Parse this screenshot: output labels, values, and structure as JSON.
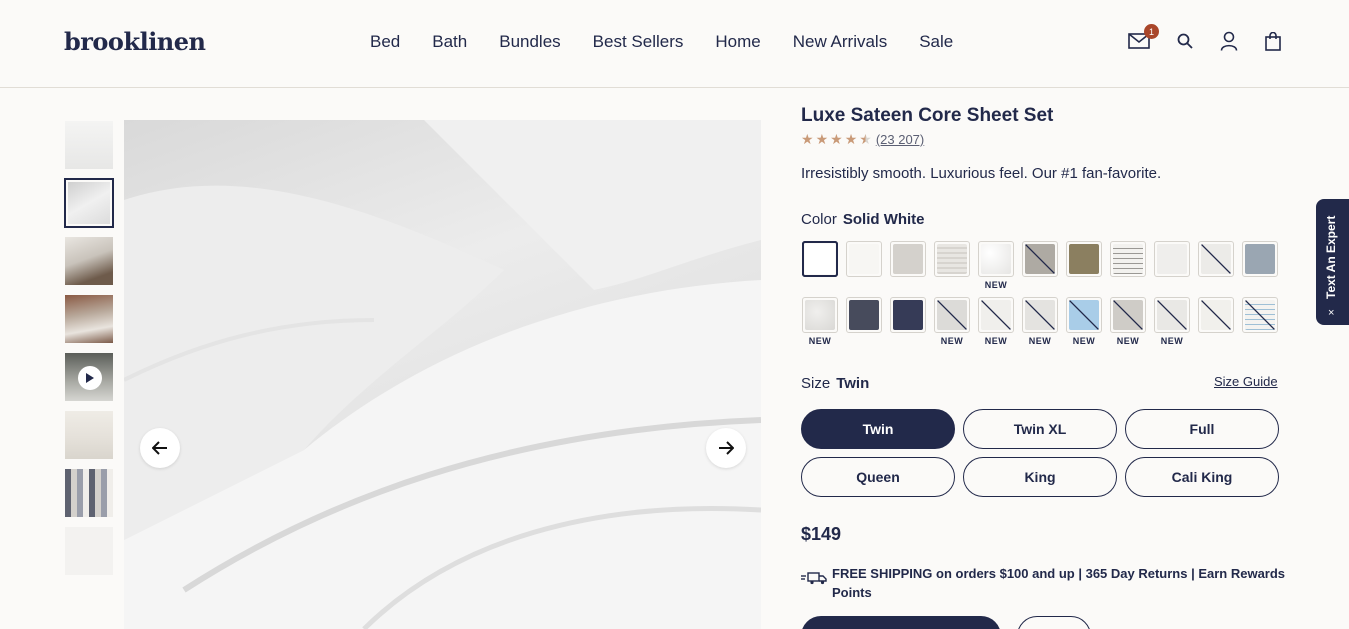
{
  "header": {
    "logo": "brooklinen",
    "nav": [
      "Bed",
      "Bath",
      "Bundles",
      "Best Sellers",
      "Home",
      "New Arrivals",
      "Sale"
    ],
    "mail_badge": "1",
    "icons": [
      "mail-icon",
      "search-icon",
      "account-icon",
      "cart-icon"
    ]
  },
  "gallery": {
    "thumbnails": [
      "thumb-1",
      "thumb-2",
      "thumb-3",
      "thumb-4",
      "thumb-video",
      "thumb-6",
      "thumb-7",
      "thumb-8"
    ],
    "active_index": 1
  },
  "product": {
    "title": "Luxe Sateen Core Sheet Set",
    "rating": 4.5,
    "review_count": "(23 207)",
    "tagline": "Irresistibly smooth. Luxurious feel. Our #1 fan-favorite.",
    "color_label": "Color",
    "color_value": "Solid White",
    "new_label": "NEW",
    "size_label": "Size",
    "size_value": "Twin",
    "size_guide": "Size Guide",
    "sizes": [
      "Twin",
      "Twin XL",
      "Full",
      "Queen",
      "King",
      "Cali King"
    ],
    "price": "$149",
    "shipping": "FREE SHIPPING on orders $100 and up | 365 Day Returns | Earn Rewards Points"
  },
  "colors": {
    "brand": "#22294a",
    "accent": "#a9462a",
    "star": "#c99a78",
    "background": "#fbfaf8"
  },
  "expert_tab": {
    "label": "Text An Expert",
    "close": "×"
  }
}
